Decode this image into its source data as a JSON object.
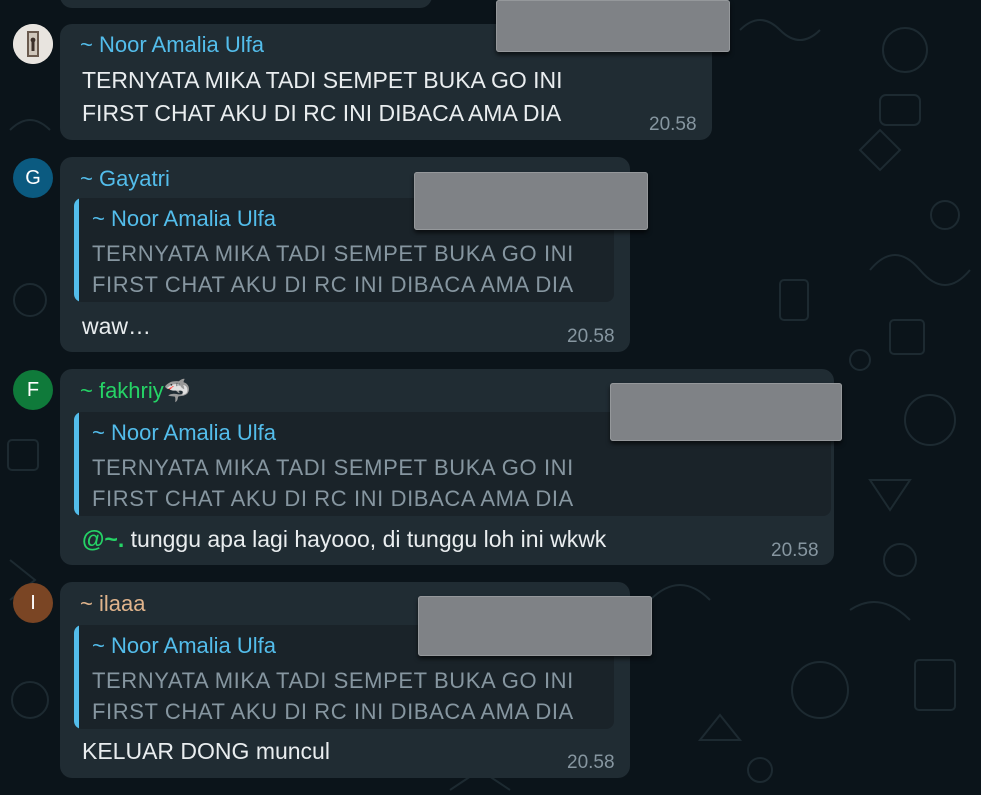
{
  "colors": {
    "background": "#0b141a",
    "bubble": "#202c33",
    "quote_bar": "#53bdeb",
    "time": "#8696a0"
  },
  "messages": [
    {
      "sender": "~ Noor Amalia Ulfa",
      "sender_color": "#53bdeb",
      "avatar": {
        "type": "photo",
        "icon": "profile-photo"
      },
      "text_lines": [
        "TERNYATA MIKA TADI SEMPET BUKA GO INI",
        "FIRST CHAT AKU DI RC INI DIBACA AMA DIA"
      ],
      "time": "20.58"
    },
    {
      "sender": "~ Gayatri",
      "sender_color": "#53bdeb",
      "avatar": {
        "type": "initial",
        "letter": "G",
        "color": "#0b5a80"
      },
      "quote": {
        "sender": "~ Noor Amalia Ulfa",
        "lines": [
          "TERNYATA MIKA TADI SEMPET BUKA GO INI",
          "FIRST CHAT AKU DI RC INI DIBACA AMA DIA"
        ]
      },
      "text": "waw…",
      "time": "20.58"
    },
    {
      "sender": "~ fakhriy🦈",
      "sender_color": "#25d366",
      "avatar": {
        "type": "initial",
        "letter": "F",
        "color": "#0f7a3a"
      },
      "quote": {
        "sender": "~ Noor Amalia Ulfa",
        "lines": [
          "TERNYATA MIKA TADI SEMPET BUKA GO INI",
          "FIRST CHAT AKU DI RC INI DIBACA AMA DIA"
        ]
      },
      "mention": "@~.",
      "text": " tunggu apa lagi hayooo, di tunggu loh ini wkwk",
      "time": "20.58"
    },
    {
      "sender": "~ ilaaa",
      "sender_color": "#e0b48c",
      "avatar": {
        "type": "initial",
        "letter": "I",
        "color": "#7a4524"
      },
      "quote": {
        "sender": "~ Noor Amalia Ulfa",
        "lines": [
          "TERNYATA MIKA TADI SEMPET BUKA GO INI",
          "FIRST CHAT AKU DI RC INI DIBACA AMA DIA"
        ]
      },
      "text": "KELUAR DONG muncul",
      "time": "20.58"
    }
  ]
}
